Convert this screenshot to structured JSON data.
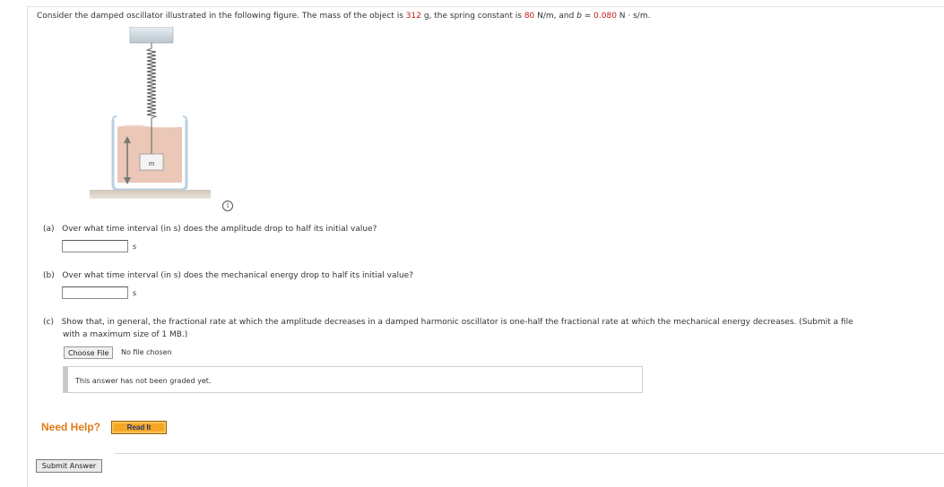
{
  "question": {
    "prefix": "Consider the damped oscillator illustrated in the following figure. The mass of the object is ",
    "mass_value": "312",
    "mass_unit": " g, the spring constant is ",
    "k_value": "80",
    "k_unit": " N/m, and ",
    "b_symbol": "b",
    "b_eq": " = ",
    "b_value": "0.080",
    "b_unit": " N · s/m."
  },
  "figure": {
    "mass_label": "m",
    "info_icon": "i"
  },
  "part_a": {
    "letter": "(a)",
    "text": "Over what time interval (in s) does the amplitude drop to half its initial value?",
    "unit": "s"
  },
  "part_b": {
    "letter": "(b)",
    "text": "Over what time interval (in s) does the mechanical energy drop to half its initial value?",
    "unit": "s"
  },
  "part_c": {
    "letter": "(c)",
    "text_line1": "Show that, in general, the fractional rate at which the amplitude decreases in a damped harmonic oscillator is one-half the fractional rate at which the mechanical energy decreases. (Submit a file",
    "text_line2": "with a maximum size of 1 MB.)",
    "choose_file_label": "Choose File",
    "file_status": "No file chosen",
    "graded_text": "This answer has not been graded yet."
  },
  "help": {
    "need_help": "Need Help?",
    "read_it": "Read It"
  },
  "submit_label": "Submit Answer",
  "colors": {
    "value_red": "#c41a1a",
    "help_orange": "#e07b14",
    "read_it_bg": "#f6a623"
  }
}
